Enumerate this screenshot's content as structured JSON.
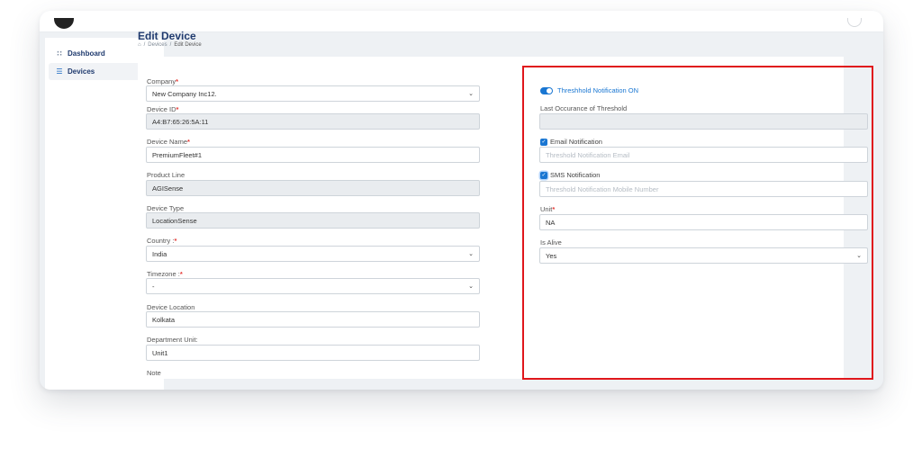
{
  "sidebar": {
    "items": [
      {
        "label": "Dashboard",
        "icon": "grid-icon"
      },
      {
        "label": "Devices",
        "icon": "devices-icon"
      }
    ]
  },
  "header": {
    "title": "Edit Device",
    "breadcrumb": [
      "Devices",
      "Edit Device"
    ]
  },
  "form": {
    "company": {
      "label": "Company",
      "value": "New Company Inc12."
    },
    "device_id": {
      "label": "Device ID",
      "value": "A4:B7:65:26:5A:11"
    },
    "device_name": {
      "label": "Device Name",
      "value": "PremiumFleet#1"
    },
    "product_line": {
      "label": "Product Line",
      "value": "AGISense"
    },
    "device_type": {
      "label": "Device Type",
      "value": "LocationSense"
    },
    "country": {
      "label": "Country :",
      "value": "India"
    },
    "timezone": {
      "label": "Timezone :",
      "value": "-"
    },
    "device_location": {
      "label": "Device Location",
      "value": "Kolkata"
    },
    "department_unit": {
      "label": "Department Unit:",
      "value": "Unit1"
    },
    "note": {
      "label": "Note"
    }
  },
  "threshold": {
    "toggle_label": "Threshhold Notification ON",
    "toggle_on": true,
    "last_occurance_label": "Last Occurance of Threshold",
    "last_occurance_value": "",
    "email": {
      "label": "Email Notification",
      "checked": true,
      "placeholder": "Threshold Notification Email"
    },
    "sms": {
      "label": "SMS Notification",
      "checked": true,
      "placeholder": "Threshold Notification Mobile Number"
    },
    "unit": {
      "label": "Unit",
      "value": "NA"
    },
    "is_alive": {
      "label": "Is Alive",
      "value": "Yes"
    }
  },
  "colors": {
    "accent": "#1976d2",
    "required": "#e53935",
    "highlight_border": "#e0171c",
    "title": "#1f3a6e"
  }
}
